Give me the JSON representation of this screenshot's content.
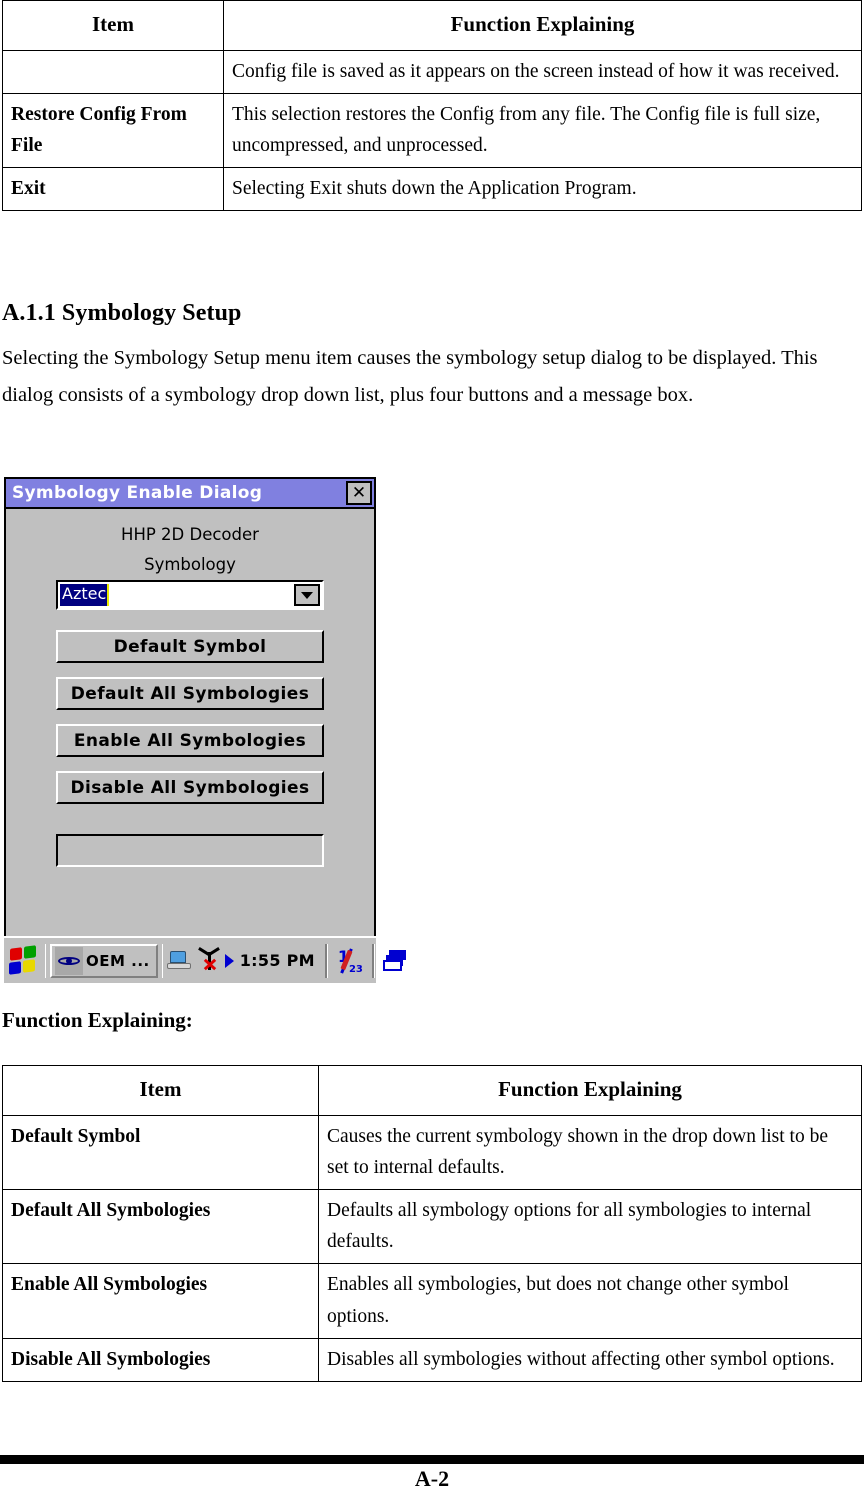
{
  "top_table": {
    "headers": [
      "Item",
      "Function Explaining"
    ],
    "rows": [
      {
        "item": "",
        "explaining": "Config file is saved as it appears on the screen instead of how it was received."
      },
      {
        "item": "Restore Config From File",
        "explaining": "This selection restores the Config from any file. The Config file is full size, uncompressed, and unprocessed."
      },
      {
        "item": "Exit",
        "explaining": "Selecting Exit shuts down the Application Program."
      }
    ]
  },
  "section": {
    "heading": "A.1.1 Symbology Setup",
    "paragraph": "Selecting the Symbology Setup menu item causes the symbology setup dialog to be displayed. This dialog consists of a symbology drop down list, plus four buttons and a message box."
  },
  "dialog": {
    "title": "Symbology Enable Dialog",
    "close_label": "✕",
    "decoder_label": "HHP 2D Decoder",
    "symbology_label": "Symbology",
    "combo_value": "Aztec",
    "buttons": [
      "Default Symbol",
      "Default All Symbologies",
      "Enable All Symbologies",
      "Disable All Symbologies"
    ],
    "message_box_value": "",
    "colors": {
      "titlebar": "#8080e0",
      "face": "#c0c0c0",
      "selection": "#000080",
      "caret": "#e8e800"
    }
  },
  "taskbar": {
    "task_button_label": "OEM ...",
    "clock": "1:55 PM",
    "input_panel_top": "1",
    "input_panel_bottom": "23"
  },
  "function_label": "Function Explaining:",
  "bottom_table": {
    "headers": [
      "Item",
      "Function Explaining"
    ],
    "rows": [
      {
        "item": "Default Symbol",
        "explaining": "Causes the current symbology shown in the drop down list to be set to internal defaults."
      },
      {
        "item": "Default All Symbologies",
        "explaining": "Defaults all symbology options for all symbologies to internal defaults."
      },
      {
        "item": "Enable All Symbologies",
        "explaining": "Enables all symbologies, but does not change other symbol options."
      },
      {
        "item": "Disable All Symbologies",
        "explaining": "Disables all symbologies without affecting other symbol options."
      }
    ]
  },
  "footer": {
    "page_number": "A-2"
  }
}
